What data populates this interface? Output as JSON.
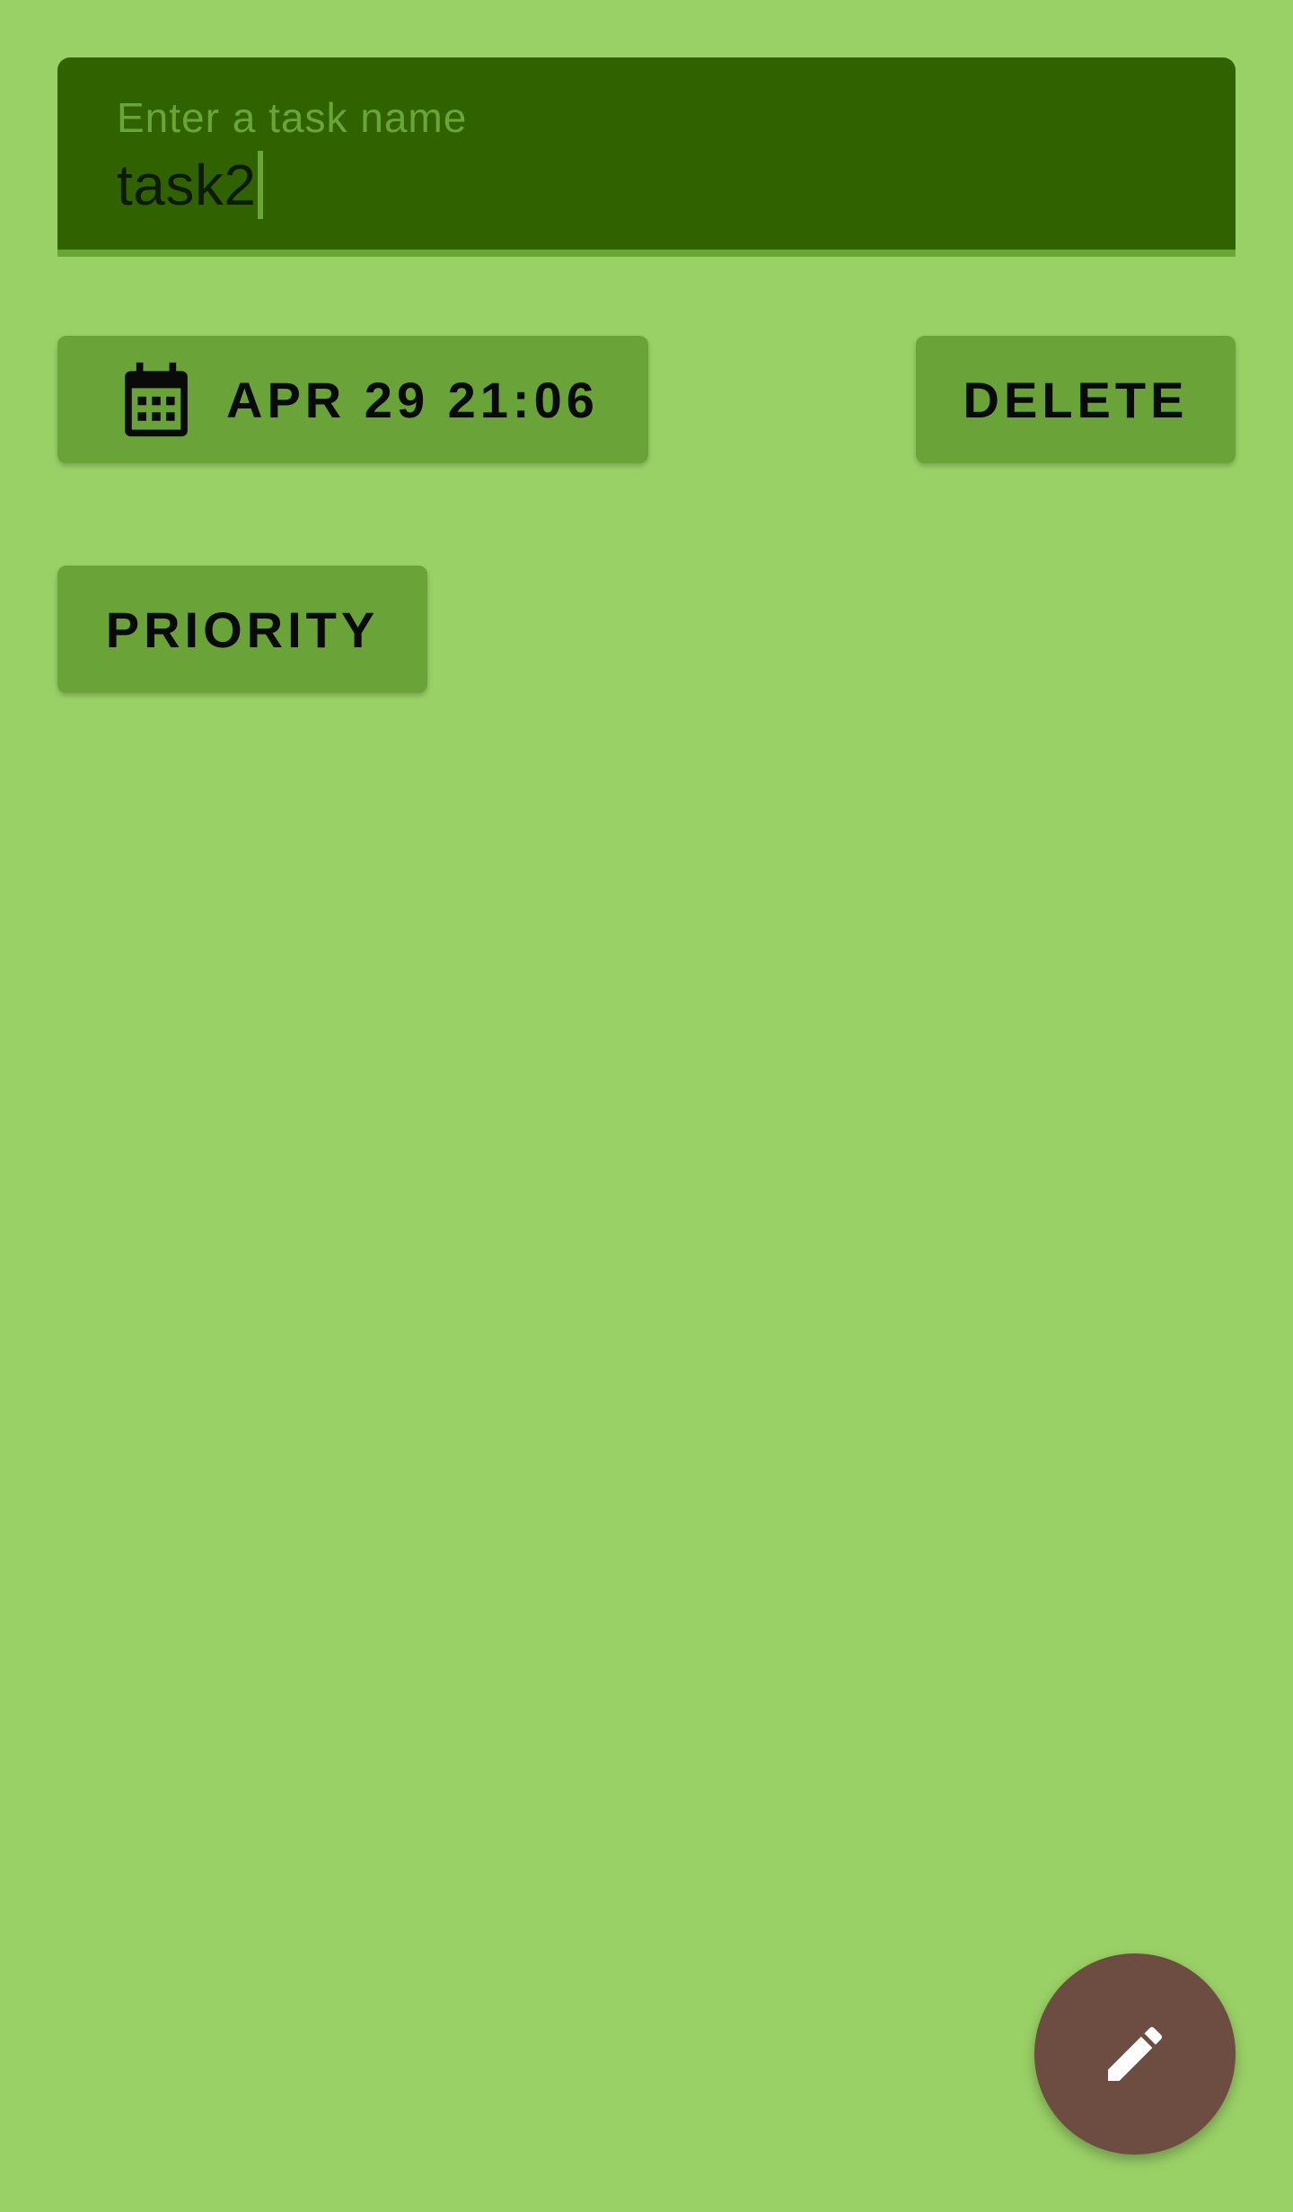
{
  "task_field": {
    "label": "Enter a task name",
    "value": "task2"
  },
  "buttons": {
    "date_label": "APR 29 21:06",
    "delete_label": "DELETE",
    "priority_label": "PRIORITY"
  },
  "icons": {
    "date": "calendar-icon",
    "fab": "pencil-icon"
  },
  "colors": {
    "background": "#9ad166",
    "field_background": "#306300",
    "button_background": "#6aa338",
    "fab_background": "#6d4c41"
  }
}
